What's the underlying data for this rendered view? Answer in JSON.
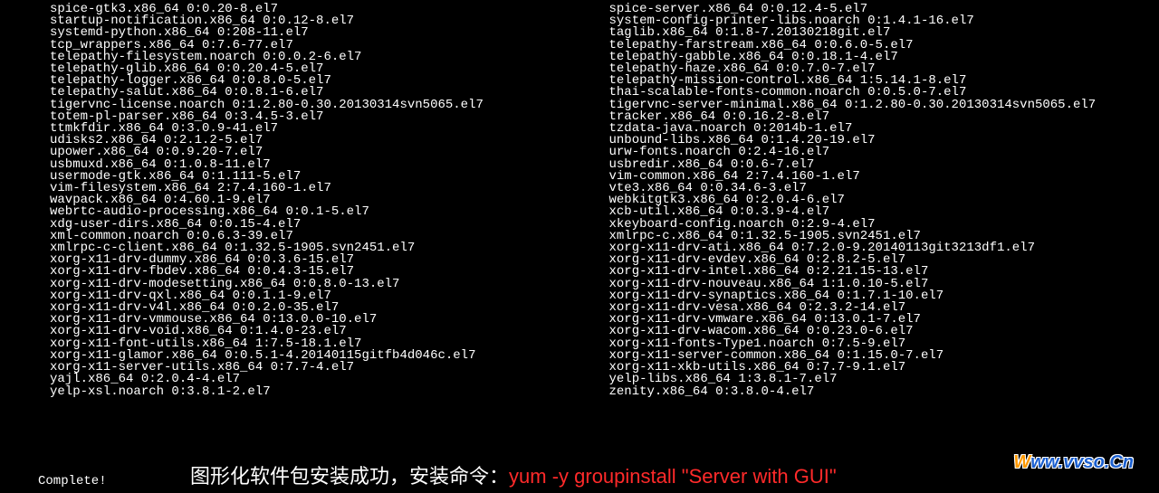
{
  "packages_left": [
    "spice-gtk3.x86_64 0:0.20-8.el7",
    "startup-notification.x86_64 0:0.12-8.el7",
    "systemd-python.x86_64 0:208-11.el7",
    "tcp_wrappers.x86_64 0:7.6-77.el7",
    "telepathy-filesystem.noarch 0:0.0.2-6.el7",
    "telepathy-glib.x86_64 0:0.20.4-5.el7",
    "telepathy-logger.x86_64 0:0.8.0-5.el7",
    "telepathy-salut.x86_64 0:0.8.1-6.el7",
    "tigervnc-license.noarch 0:1.2.80-0.30.20130314svn5065.el7",
    "totem-pl-parser.x86_64 0:3.4.5-3.el7",
    "ttmkfdir.x86_64 0:3.0.9-41.el7",
    "udisks2.x86_64 0:2.1.2-5.el7",
    "upower.x86_64 0:0.9.20-7.el7",
    "usbmuxd.x86_64 0:1.0.8-11.el7",
    "usermode-gtk.x86_64 0:1.111-5.el7",
    "vim-filesystem.x86_64 2:7.4.160-1.el7",
    "wavpack.x86_64 0:4.60.1-9.el7",
    "webrtc-audio-processing.x86_64 0:0.1-5.el7",
    "xdg-user-dirs.x86_64 0:0.15-4.el7",
    "xml-common.noarch 0:0.6.3-39.el7",
    "xmlrpc-c-client.x86_64 0:1.32.5-1905.svn2451.el7",
    "xorg-x11-drv-dummy.x86_64 0:0.3.6-15.el7",
    "xorg-x11-drv-fbdev.x86_64 0:0.4.3-15.el7",
    "xorg-x11-drv-modesetting.x86_64 0:0.8.0-13.el7",
    "xorg-x11-drv-qxl.x86_64 0:0.1.1-9.el7",
    "xorg-x11-drv-v4l.x86_64 0:0.2.0-35.el7",
    "xorg-x11-drv-vmmouse.x86_64 0:13.0.0-10.el7",
    "xorg-x11-drv-void.x86_64 0:1.4.0-23.el7",
    "xorg-x11-font-utils.x86_64 1:7.5-18.1.el7",
    "xorg-x11-glamor.x86_64 0:0.5.1-4.20140115gitfb4d046c.el7",
    "xorg-x11-server-utils.x86_64 0:7.7-4.el7",
    "yajl.x86_64 0:2.0.4-4.el7",
    "yelp-xsl.noarch 0:3.8.1-2.el7"
  ],
  "packages_right": [
    "spice-server.x86_64 0:0.12.4-5.el7",
    "system-config-printer-libs.noarch 0:1.4.1-16.el7",
    "taglib.x86_64 0:1.8-7.20130218git.el7",
    "telepathy-farstream.x86_64 0:0.6.0-5.el7",
    "telepathy-gabble.x86_64 0:0.18.1-4.el7",
    "telepathy-haze.x86_64 0:0.7.0-7.el7",
    "telepathy-mission-control.x86_64 1:5.14.1-8.el7",
    "thai-scalable-fonts-common.noarch 0:0.5.0-7.el7",
    "tigervnc-server-minimal.x86_64 0:1.2.80-0.30.20130314svn5065.el7",
    "tracker.x86_64 0:0.16.2-8.el7",
    "tzdata-java.noarch 0:2014b-1.el7",
    "unbound-libs.x86_64 0:1.4.20-19.el7",
    "urw-fonts.noarch 0:2.4-16.el7",
    "usbredir.x86_64 0:0.6-7.el7",
    "vim-common.x86_64 2:7.4.160-1.el7",
    "vte3.x86_64 0:0.34.6-3.el7",
    "webkitgtk3.x86_64 0:2.0.4-6.el7",
    "xcb-util.x86_64 0:0.3.9-4.el7",
    "xkeyboard-config.noarch 0:2.9-4.el7",
    "xmlrpc-c.x86_64 0:1.32.5-1905.svn2451.el7",
    "xorg-x11-drv-ati.x86_64 0:7.2.0-9.20140113git3213df1.el7",
    "xorg-x11-drv-evdev.x86_64 0:2.8.2-5.el7",
    "xorg-x11-drv-intel.x86_64 0:2.21.15-13.el7",
    "xorg-x11-drv-nouveau.x86_64 1:1.0.10-5.el7",
    "xorg-x11-drv-synaptics.x86_64 0:1.7.1-10.el7",
    "xorg-x11-drv-vesa.x86_64 0:2.3.2-14.el7",
    "xorg-x11-drv-vmware.x86_64 0:13.0.1-7.el7",
    "xorg-x11-drv-wacom.x86_64 0:0.23.0-6.el7",
    "xorg-x11-fonts-Type1.noarch 0:7.5-9.el7",
    "xorg-x11-server-common.x86_64 0:1.15.0-7.el7",
    "xorg-x11-xkb-utils.x86_64 0:7.7-9.1.el7",
    "yelp-libs.x86_64 1:3.8.1-7.el7",
    "zenity.x86_64 0:3.8.0-4.el7"
  ],
  "complete_label": "Complete!",
  "annotation": {
    "white": "图形化软件包安装成功，安装命令：",
    "red": "yum  -y  groupinstall \"Server with GUI\""
  },
  "watermark": {
    "first": "W",
    "rest": "ww.vvso.Cn"
  }
}
